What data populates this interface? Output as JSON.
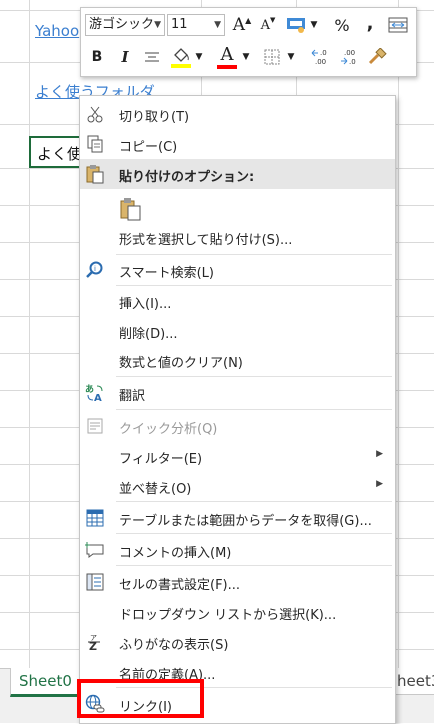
{
  "sheet": {
    "cell_yahoo": "Yahoo",
    "cell_folder_link": "よく使うフォルダ",
    "active_cell_text": "よく使"
  },
  "tabs": {
    "left": "Sheet0",
    "right": "heet3"
  },
  "toolbar": {
    "font_name": "游ゴシック",
    "font_size": "11",
    "percent": "%",
    "comma": ",",
    "bold": "B",
    "italic": "I",
    "font_color_glyph": "A",
    "grow_font": "A",
    "shrink_font": "A",
    "inc_decimal": "←.0\n.00",
    "dec_decimal": ".00\n→.0",
    "accent_fill": "#ffff00",
    "accent_font": "#ff0000"
  },
  "menu": {
    "cut": "切り取り(T)",
    "copy": "コピー(C)",
    "paste_options": "貼り付けのオプション:",
    "paste_special": "形式を選択して貼り付け(S)...",
    "smart_lookup": "スマート検索(L)",
    "insert": "挿入(I)...",
    "delete": "削除(D)...",
    "clear_contents": "数式と値のクリア(N)",
    "translate": "翻訳",
    "quick_analysis": "クイック分析(Q)",
    "filter": "フィルター(E)",
    "sort": "並べ替え(O)",
    "get_data": "テーブルまたは範囲からデータを取得(G)...",
    "insert_comment": "コメントの挿入(M)",
    "format_cells": "セルの書式設定(F)...",
    "pick_from_list": "ドロップダウン リストから選択(K)...",
    "show_phonetic": "ふりがなの表示(S)",
    "define_name": "名前の定義(A)...",
    "link": "リンク(I)"
  },
  "colors": {
    "highlight": "#ff0000",
    "excel_green": "#217346"
  }
}
